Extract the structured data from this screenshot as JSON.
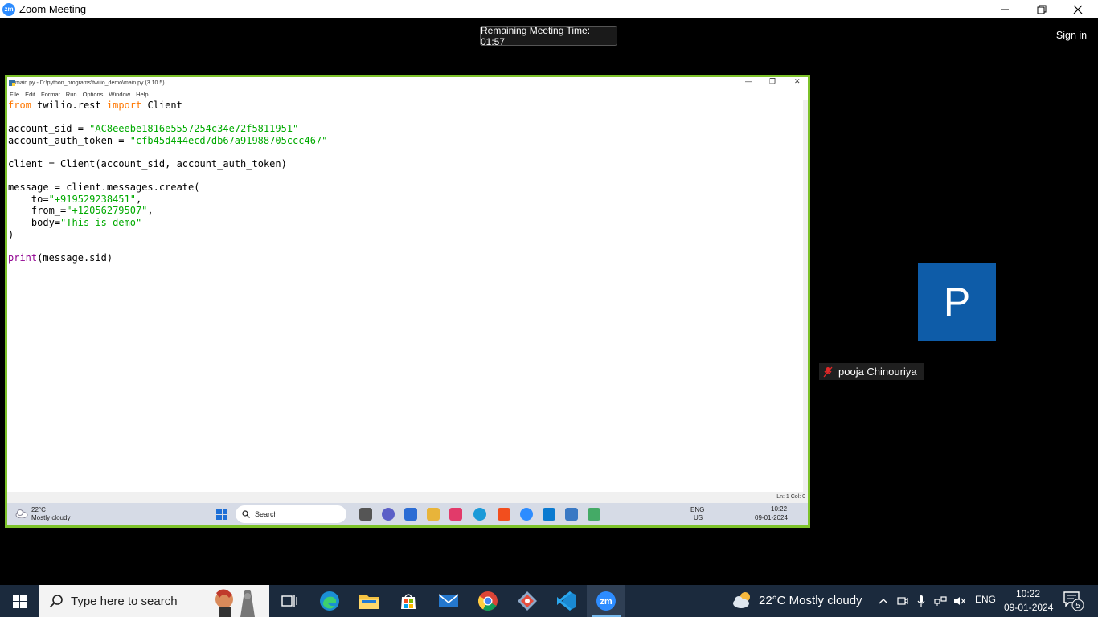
{
  "zoom": {
    "window_title": "Zoom Meeting",
    "logo_text": "zm",
    "remaining_time": "Remaining Meeting Time: 01:57",
    "sign_in": "Sign in"
  },
  "idle": {
    "title": "main.py - D:\\python_programs\\twilio_demo\\main.py (3.10.5)",
    "menu": [
      "File",
      "Edit",
      "Format",
      "Run",
      "Options",
      "Window",
      "Help"
    ],
    "status": "Ln: 1   Col: 0",
    "code_lines": [
      "from twilio.rest import Client",
      "",
      "account_sid = \"AC8eeebe1816e5557254c34e72f5811951\"",
      "account_auth_token = \"cfb45d444ecd7db67a91988705ccc467\"",
      "",
      "client = Client(account_sid, account_auth_token)",
      "",
      "message = client.messages.create(",
      "    to=\"+919529238451\",",
      "    from_=\"+12056279507\",",
      "    body=\"This is demo\"",
      ")",
      "",
      "print(message.sid)"
    ]
  },
  "inner_taskbar": {
    "weather_temp": "22°C",
    "weather_desc": "Mostly cloudy",
    "search": "Search",
    "lang1": "ENG",
    "lang2": "US",
    "time": "10:22",
    "date": "09-01-2024"
  },
  "participant": {
    "initial": "P",
    "name": "pooja Chinouriya"
  },
  "taskbar": {
    "search_placeholder": "Type here to search",
    "weather": "22°C  Mostly cloudy",
    "lang": "ENG",
    "time": "10:22",
    "date": "09-01-2024",
    "notifications": "5"
  },
  "colors": {
    "share_border": "#7dc22a",
    "participant_tile": "#0e5ca8",
    "taskbar": "#1b2a3d"
  }
}
